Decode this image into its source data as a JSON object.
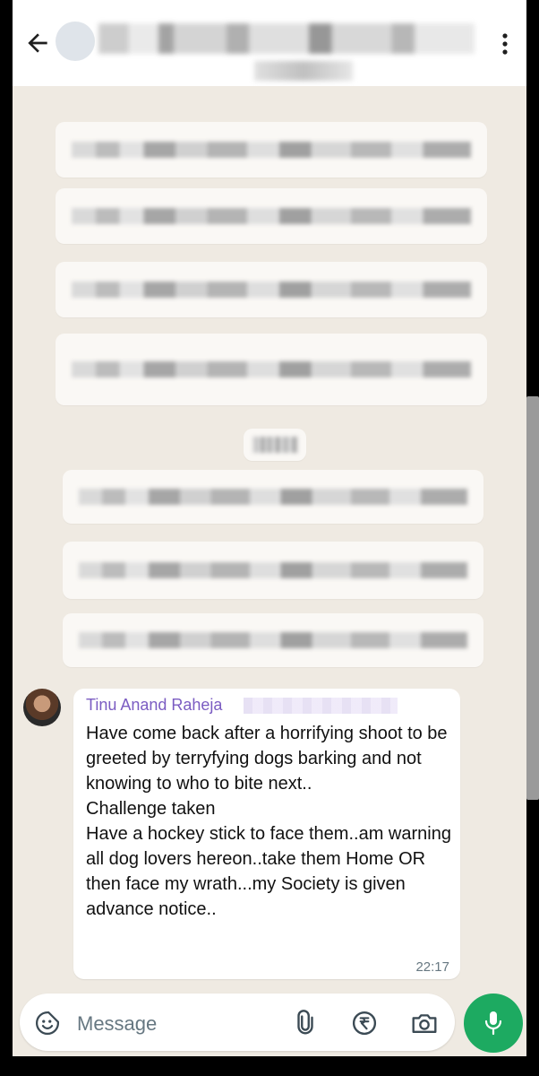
{
  "header": {
    "back_icon": "arrow-left-icon",
    "menu_icon": "more-vertical-icon"
  },
  "message": {
    "sender_name": "Tinu Anand Raheja",
    "text": "Have come back after  a horrifying shoot to be greeted by terryfying dogs barking and not knowing to who to bite next..\nChallenge taken\nHave a hockey stick to face them..am warning all dog lovers hereon..take them Home OR then face my wrath...my Society is given advance notice..",
    "time": "22:17"
  },
  "composer": {
    "placeholder": "Message",
    "sticker_icon": "sticker-icon",
    "attach_icon": "paperclip-icon",
    "payment_icon": "rupee-icon",
    "camera_icon": "camera-icon",
    "mic_icon": "microphone-icon"
  },
  "colors": {
    "chat_background": "#efeae2",
    "sender_name": "#7b5cc2",
    "mic_button": "#1daa61",
    "timestamp": "#667781"
  }
}
